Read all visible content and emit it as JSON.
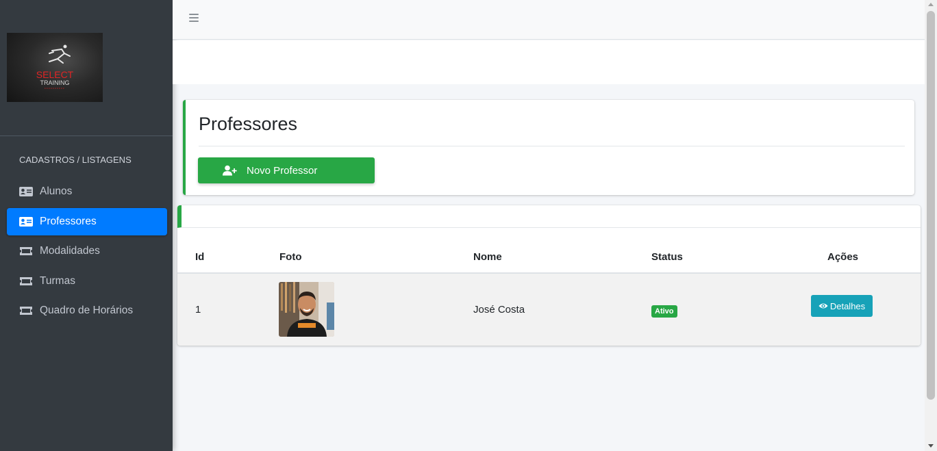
{
  "sidebar": {
    "logo": {
      "text_line1": "SELECT",
      "text_line2": "TRAINING",
      "icon": "runner-logo-icon"
    },
    "section_header": "CADASTROS / LISTAGENS",
    "items": [
      {
        "label": "Alunos",
        "icon": "id-card-icon",
        "active": false
      },
      {
        "label": "Professores",
        "icon": "id-card-icon",
        "active": true
      },
      {
        "label": "Modalidades",
        "icon": "ticket-icon",
        "active": false
      },
      {
        "label": "Turmas",
        "icon": "ticket-icon",
        "active": false
      },
      {
        "label": "Quadro de Horários",
        "icon": "ticket-icon",
        "active": false
      }
    ]
  },
  "topbar": {
    "menu_icon": "hamburger-icon"
  },
  "page": {
    "title": "Professores",
    "new_button_label": "Novo Professor",
    "new_button_icon": "user-plus-icon"
  },
  "table": {
    "columns": [
      "Id",
      "Foto",
      "Nome",
      "Status",
      "Ações"
    ],
    "rows": [
      {
        "id": "1",
        "photo": "professor-photo",
        "name": "José Costa",
        "status": "Ativo",
        "action_label": "Detalhes",
        "action_icon": "eye-icon"
      }
    ]
  },
  "colors": {
    "sidebar_bg": "#343a40",
    "active_item": "#007bff",
    "success": "#28a745",
    "info": "#17a2b8"
  }
}
